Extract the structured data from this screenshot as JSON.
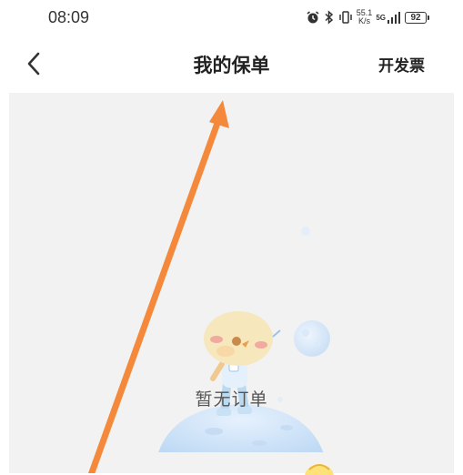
{
  "status_bar": {
    "time": "08:09",
    "net_speed_value": "55.1",
    "net_speed_unit": "K/s",
    "network_type": "5G",
    "battery_level": "92",
    "icons": [
      "alarm-icon",
      "bluetooth-icon",
      "vibrate-icon",
      "signal-icon",
      "battery-icon"
    ]
  },
  "nav": {
    "title": "我的保单",
    "action_label": "开发票",
    "back_icon": "chevron-left-icon"
  },
  "empty_state": {
    "message": "暂无订单",
    "illustration": "astronaut-chick-on-moon"
  },
  "colors": {
    "content_background": "#f2f2f2",
    "annotation_arrow": "#f5893b"
  }
}
